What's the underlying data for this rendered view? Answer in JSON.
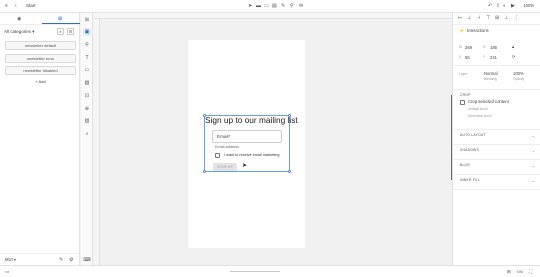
{
  "topbar": {
    "menu_icon": "≡",
    "back_icon": "‹",
    "title": "Start",
    "zoom": "100%"
  },
  "left_panel": {
    "category": "All categories",
    "variants": [
      {
        "label": "newsletter default"
      },
      {
        "label": "newsletter error"
      },
      {
        "label": "newsletter disabled"
      }
    ],
    "add_label": "+ Add",
    "footer_label": "MUI"
  },
  "form": {
    "title": "Sign up to our mailing list",
    "email_placeholder": "Email*",
    "email_helper": "Email address",
    "checkbox_label": "I want to receive email marketing",
    "button_label": "SIGN UP"
  },
  "right_panel": {
    "interactions_label": "Interactions",
    "w_label": "W",
    "w_value": "269",
    "h_label": "H",
    "h_value": "185",
    "x_label": "X",
    "x_value": "55",
    "y_label": "Y",
    "y_value": "241",
    "layer_label": "Layer",
    "blending_value": "Normal",
    "blending_label": "Blending",
    "opacity_value": "100%",
    "opacity_label": "Opacity",
    "crop_section": "CROP",
    "crop_checkbox": "Crop selected content",
    "vertical_scroll": "Vertical scroll",
    "horizontal_scroll": "Horizontal scroll",
    "sections": [
      "AUTO LAYOUT",
      "SHADOWS",
      "BLUR",
      "INNER FILL"
    ]
  },
  "bottombar": {
    "status": "ON"
  }
}
